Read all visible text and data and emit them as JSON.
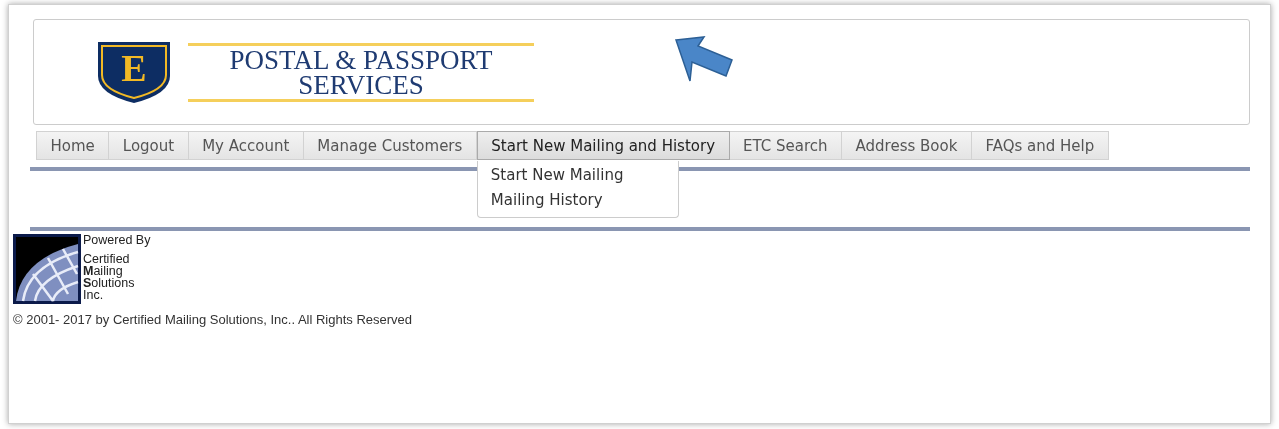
{
  "header": {
    "logo_letter": "E",
    "title_line_1": "POSTAL & PASSPORT",
    "title_line_2": "SERVICES"
  },
  "nav": [
    {
      "label": "Home",
      "selected": false
    },
    {
      "label": "Logout",
      "selected": false
    },
    {
      "label": "My Account",
      "selected": false
    },
    {
      "label": "Manage Customers",
      "selected": false
    },
    {
      "label": "Start New Mailing and History",
      "selected": true,
      "expanded": true,
      "children": [
        {
          "label": "Start New Mailing"
        },
        {
          "label": "Mailing History"
        }
      ]
    },
    {
      "label": "ETC Search",
      "selected": false
    },
    {
      "label": "Address Book",
      "selected": false
    },
    {
      "label": "FAQs and Help",
      "selected": false
    }
  ],
  "footer": {
    "powered_by": "Powered By",
    "company_lines": [
      "Certified",
      "**M**ailing",
      "**S**olutions",
      "Inc."
    ],
    "copyright": "© 2001- 2017 by Certified Mailing Solutions, Inc.. All Rights Reserved"
  }
}
